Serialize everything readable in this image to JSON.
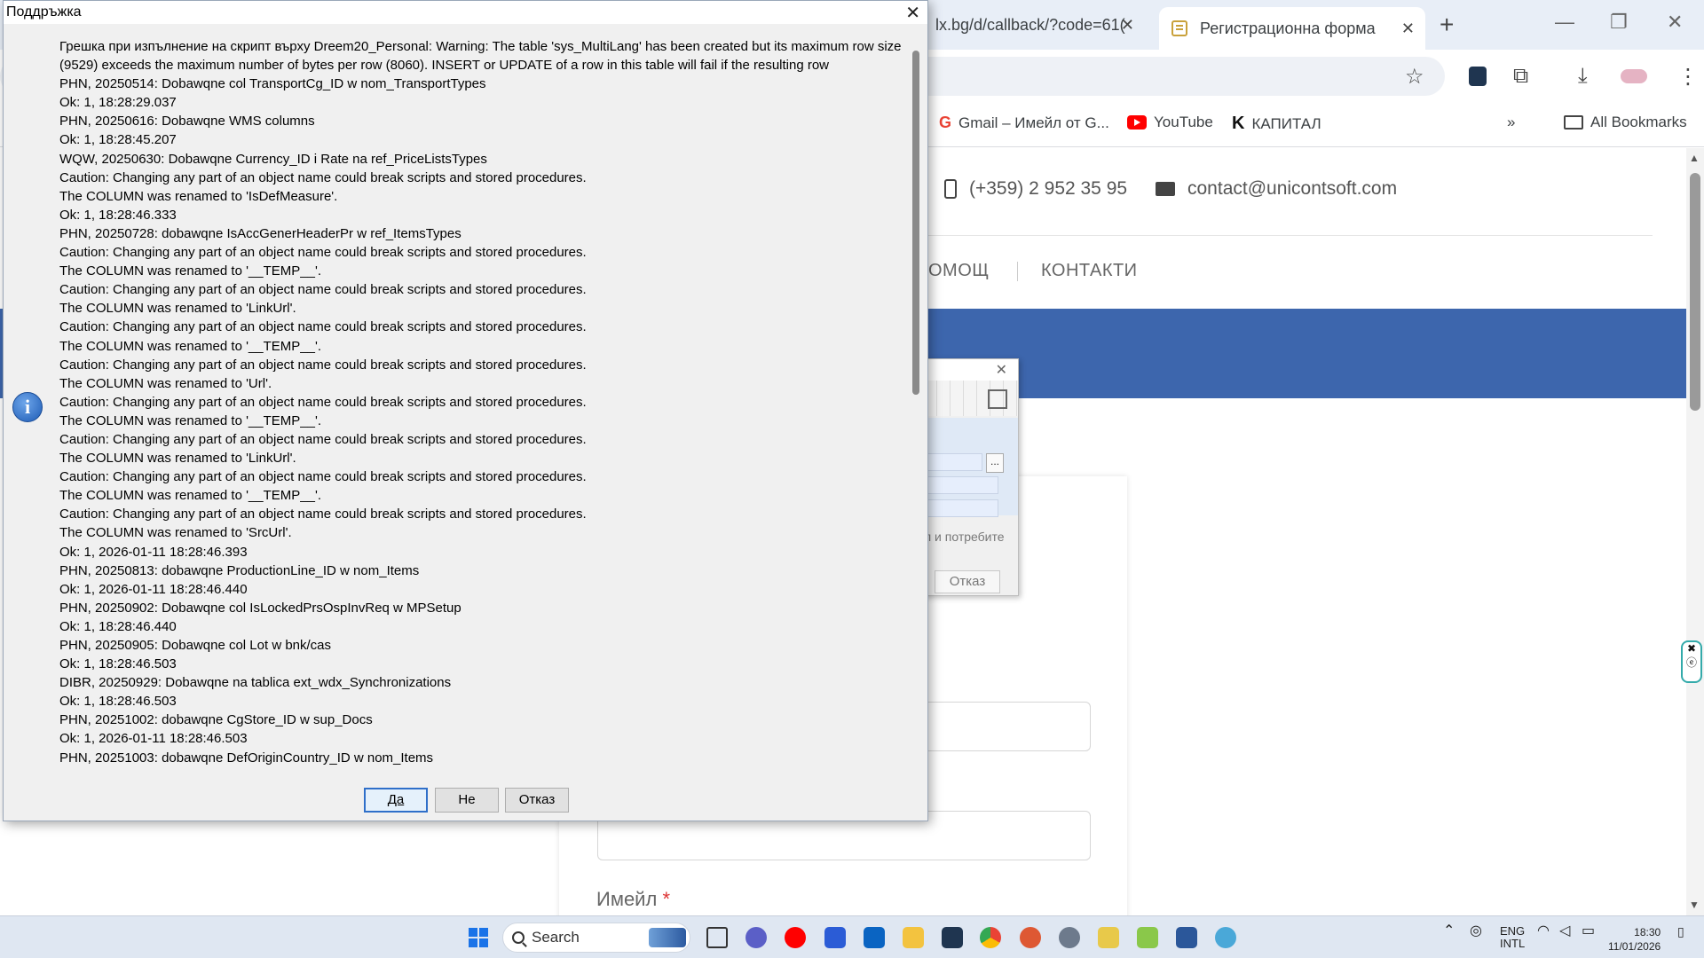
{
  "browser": {
    "tabs": [
      {
        "label": "lx.bg/d/callback/?code=61(",
        "active": false
      },
      {
        "label": "Регистрационна форма",
        "active": true
      }
    ],
    "bookmarks": [
      {
        "label": "Gmail – Имейл от G...",
        "icon": "gmail-icon"
      },
      {
        "label": "YouTube",
        "icon": "youtube-icon"
      },
      {
        "label": "КАПИТАЛ",
        "icon": "kapital-icon"
      }
    ],
    "all_bookmarks": "All Bookmarks",
    "more_bookmarks": "»"
  },
  "site": {
    "phone": "(+359) 2 952 35 95",
    "email": "contact@unicontsoft.com",
    "nav": [
      "ОМОЩ",
      "КОНТАКТИ"
    ],
    "email_label": "Имейл",
    "required_mark": "*",
    "accent_color": "#3d66ad"
  },
  "bg_dialog": {
    "ellipsis": "...",
    "text": "л и потребите",
    "cancel": "Отказ"
  },
  "dialog": {
    "title": "Поддръжка",
    "close": "✕",
    "first_line": "Грешка при изпълнение на скрипт върху Dreem20_Personal: Warning: The table 'sys_MultiLang' has been created but its maximum row size (9529) exceeds the maximum number of bytes per row (8060). INSERT or UPDATE of a row in this table will fail if the resulting row",
    "lines": [
      "PHN, 20250514: Dobawqne col TransportCg_ID w nom_TransportTypes",
      "Ok: 1, 18:28:29.037",
      "PHN, 20250616: Dobawqne WMS columns",
      "Ok: 1, 18:28:45.207",
      "WQW, 20250630: Dobawqne Currency_ID i Rate na ref_PriceListsTypes",
      "Caution: Changing any part of an object name could break scripts and stored procedures.",
      "The COLUMN was renamed to 'IsDefMeasure'.",
      "Ok: 1, 18:28:46.333",
      "PHN, 20250728: dobawqne IsAccGenerHeaderPr w ref_ItemsTypes",
      "Caution: Changing any part of an object name could break scripts and stored procedures.",
      "The COLUMN was renamed to '__TEMP__'.",
      "Caution: Changing any part of an object name could break scripts and stored procedures.",
      "The COLUMN was renamed to 'LinkUrl'.",
      "Caution: Changing any part of an object name could break scripts and stored procedures.",
      "The COLUMN was renamed to '__TEMP__'.",
      "Caution: Changing any part of an object name could break scripts and stored procedures.",
      "The COLUMN was renamed to 'Url'.",
      "Caution: Changing any part of an object name could break scripts and stored procedures.",
      "The COLUMN was renamed to '__TEMP__'.",
      "Caution: Changing any part of an object name could break scripts and stored procedures.",
      "The COLUMN was renamed to 'LinkUrl'.",
      "Caution: Changing any part of an object name could break scripts and stored procedures.",
      "The COLUMN was renamed to '__TEMP__'.",
      "Caution: Changing any part of an object name could break scripts and stored procedures.",
      "The COLUMN was renamed to 'SrcUrl'.",
      "Ok: 1, 2026-01-11 18:28:46.393",
      "PHN, 20250813: dobawqne ProductionLine_ID w nom_Items",
      "Ok: 1, 2026-01-11 18:28:46.440",
      "PHN, 20250902: Dobawqne col IsLockedPrsOspInvReq w MPSetup",
      "Ok: 1, 18:28:46.440",
      "PHN, 20250905: Dobawqne col Lot w bnk/cas",
      "Ok: 1, 18:28:46.503",
      "DIBR, 20250929: Dobawqne na tablica ext_wdx_Synchronizations",
      "Ok: 1, 18:28:46.503",
      "PHN, 20251002: dobawqne CgStore_ID w sup_Docs",
      "Ok: 1, 2026-01-11 18:28:46.503",
      "PHN, 20251003: dobawqne DefOriginCountry_ID w nom_Items"
    ],
    "buttons": {
      "yes": "Да",
      "no": "Не",
      "cancel": "Отказ"
    }
  },
  "taskbar": {
    "search": "Search",
    "lang_top": "ENG",
    "lang_bottom": "INTL",
    "time": "18:30",
    "date": "11/01/2026"
  }
}
